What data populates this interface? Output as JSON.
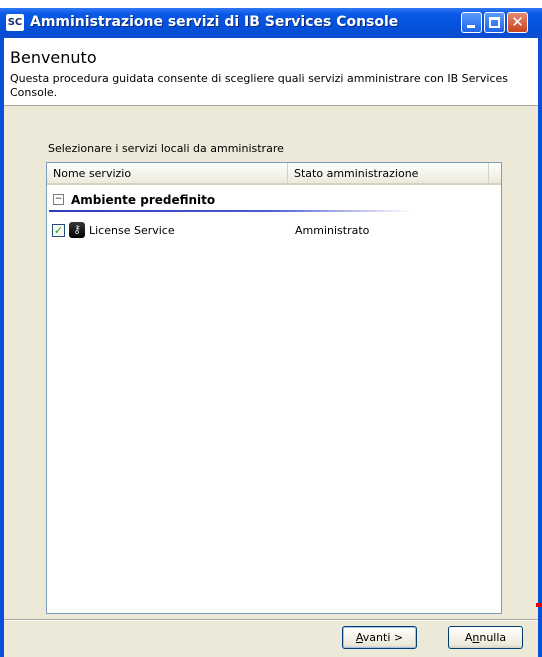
{
  "window": {
    "icon_text": "SC",
    "title": "Amministrazione servizi di IB Services Console",
    "close_glyph": "✕"
  },
  "wizard": {
    "title": "Benvenuto",
    "description": "Questa procedura guidata consente di scegliere quali servizi amministrare con IB Services Console."
  },
  "services": {
    "label": "Selezionare i servizi locali da amministrare",
    "columns": [
      "Nome servizio",
      "Stato amministrazione"
    ],
    "group": {
      "expander": "−",
      "label": "Ambiente predefinito"
    },
    "items": [
      {
        "name": "License Service",
        "state": "Amministrato",
        "checked": true
      }
    ]
  },
  "buttons": {
    "next": {
      "mnemonic": "A",
      "rest": "vanti >"
    },
    "cancel": {
      "prefix": "A",
      "mnemonic": "n",
      "rest": "nulla"
    }
  },
  "colors": {
    "titlebar": "#0451dc",
    "dialog_bg": "#ece9d8",
    "group_line": "#2a3dbd",
    "check": "#21a121"
  },
  "icons": {
    "checkbox": "✓",
    "service": "key-icon"
  }
}
